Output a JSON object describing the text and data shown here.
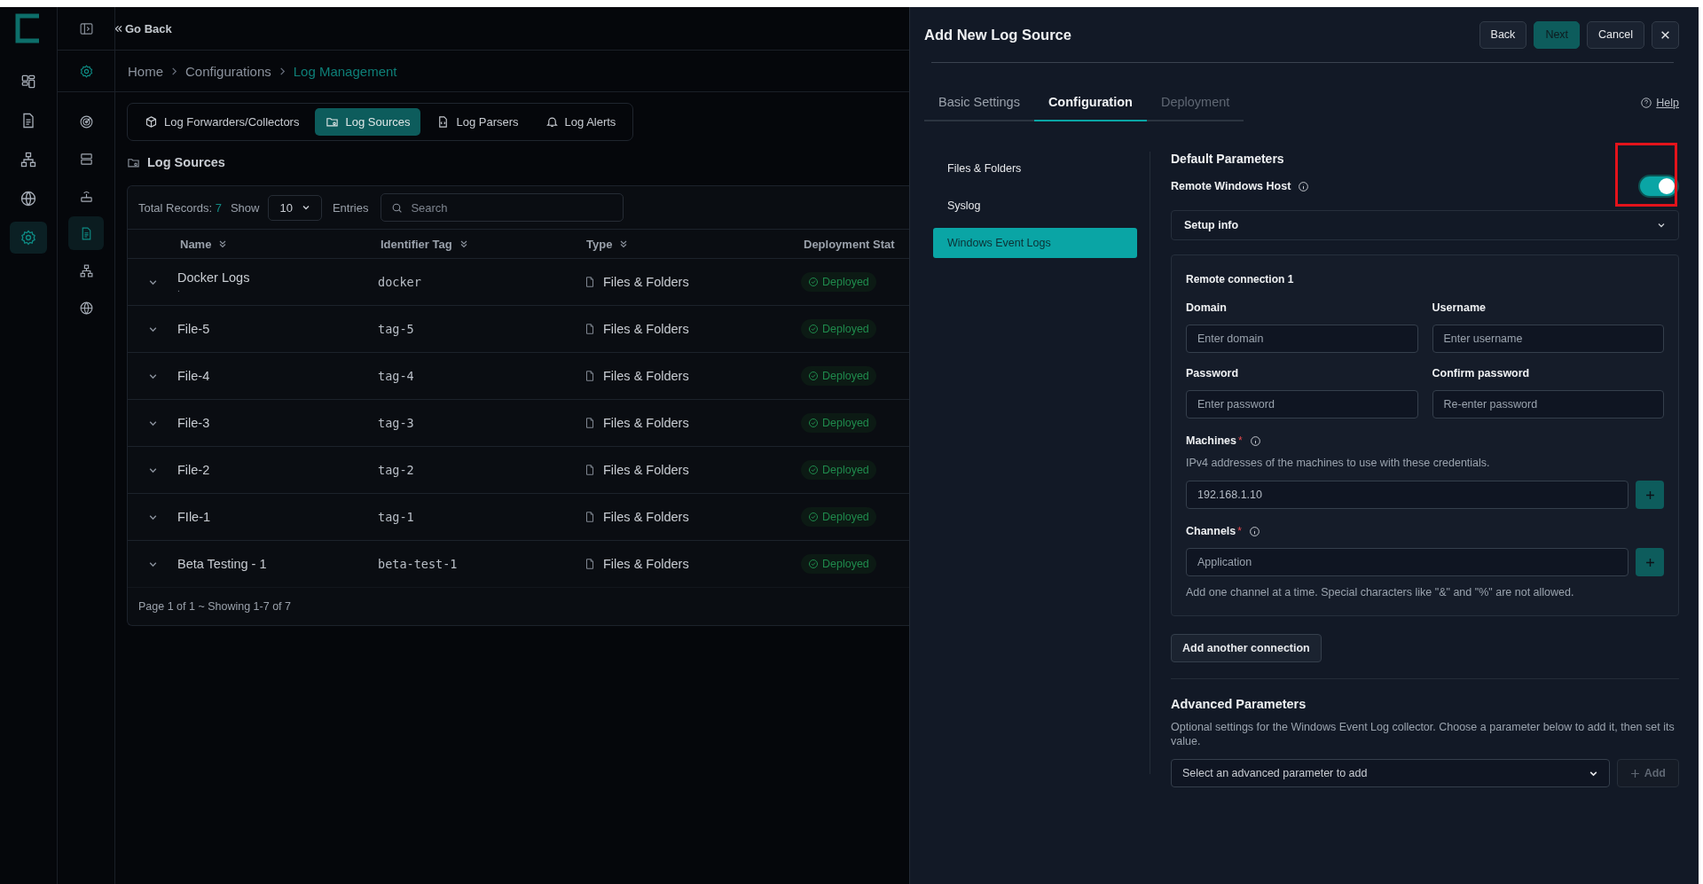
{
  "app_rail": {
    "items": [
      {
        "kind": "dashboard",
        "selected": false
      },
      {
        "kind": "document",
        "selected": false
      },
      {
        "kind": "network",
        "selected": false
      },
      {
        "kind": "globe",
        "selected": false
      },
      {
        "kind": "settings",
        "selected": true
      }
    ]
  },
  "nav_rail": {
    "items": [
      {
        "kind": "settings",
        "selected": false
      },
      {
        "kind": "radar",
        "selected": false
      },
      {
        "kind": "server",
        "selected": false
      },
      {
        "kind": "router",
        "selected": false
      },
      {
        "kind": "document",
        "selected": true
      },
      {
        "kind": "network",
        "selected": false
      },
      {
        "kind": "globe",
        "selected": false
      }
    ]
  },
  "topbar": {
    "go_back": "Go Back"
  },
  "breadcrumb": [
    {
      "label": "Home",
      "current": false
    },
    {
      "label": "Configurations",
      "current": false
    },
    {
      "label": "Log Management",
      "current": true
    }
  ],
  "section_tabs": [
    {
      "label": "Log Forwarders/Collectors",
      "kind": "box",
      "selected": false
    },
    {
      "label": "Log Sources",
      "kind": "folder",
      "selected": true
    },
    {
      "label": "Log Parsers",
      "kind": "code",
      "selected": false
    },
    {
      "label": "Log Alerts",
      "kind": "bell",
      "selected": false
    }
  ],
  "section_title": "Log Sources",
  "table": {
    "total_label": "Total Records:",
    "total": "7",
    "show_label": "Show",
    "page_size": "10",
    "entries_label": "Entries",
    "search_placeholder": "Search",
    "columns": [
      "Name",
      "Identifier Tag",
      "Type",
      "Deployment Stat"
    ],
    "rows": [
      {
        "name": "Docker Logs",
        "description": ".",
        "tag": "docker",
        "type": "Files & Folders",
        "status": "Deployed"
      },
      {
        "name": "File-5",
        "tag": "tag-5",
        "type": "Files & Folders",
        "status": "Deployed"
      },
      {
        "name": "File-4",
        "tag": "tag-4",
        "type": "Files & Folders",
        "status": "Deployed"
      },
      {
        "name": "File-3",
        "tag": "tag-3",
        "type": "Files & Folders",
        "status": "Deployed"
      },
      {
        "name": "File-2",
        "tag": "tag-2",
        "type": "Files & Folders",
        "status": "Deployed"
      },
      {
        "name": "FIle-1",
        "tag": "tag-1",
        "type": "Files & Folders",
        "status": "Deployed"
      },
      {
        "name": "Beta Testing - 1",
        "tag": "beta-test-1",
        "type": "Files & Folders",
        "status": "Deployed"
      }
    ],
    "footer": "Page 1 of 1 ~ Showing 1-7 of 7"
  },
  "panel": {
    "title": "Add New Log Source",
    "buttons": [
      {
        "label": "Back",
        "kind": "secondary"
      },
      {
        "label": "Next",
        "kind": "primary"
      },
      {
        "label": "Cancel",
        "kind": "secondary"
      }
    ],
    "tabs": [
      {
        "label": "Basic Settings",
        "selected": false,
        "disabled": false
      },
      {
        "label": "Configuration",
        "selected": true,
        "disabled": false
      },
      {
        "label": "Deployment",
        "selected": false,
        "disabled": true
      }
    ],
    "help": "Help",
    "source_types": [
      {
        "label": "Files & Folders",
        "selected": false
      },
      {
        "label": "Syslog",
        "selected": false
      },
      {
        "label": "Windows Event Logs",
        "selected": true
      }
    ],
    "default_title": "Default Parameters",
    "remote_host": {
      "label": "Remote Windows Host",
      "on": true,
      "highlighted": true
    },
    "setup_info": {
      "label": "Setup info",
      "expanded": false
    },
    "connection": {
      "title": "Remote connection 1",
      "fields": [
        {
          "label": "Domain",
          "placeholder": "Enter domain"
        },
        {
          "label": "Username",
          "placeholder": "Enter username"
        },
        {
          "label": "Password",
          "placeholder": "Enter password"
        },
        {
          "label": "Confirm password",
          "placeholder": "Re-enter password"
        }
      ],
      "machines": {
        "label": "Machines",
        "required_mark": "*",
        "help": "IPv4 addresses of the machines to use with these credentials.",
        "value": "192.168.1.10"
      },
      "channels": {
        "label": "Channels",
        "required_mark": "*",
        "placeholder": "Application",
        "hint": "Add one channel at a time. Special characters like \"&\" and \"%\" are not allowed."
      }
    },
    "add_connection": "Add another connection",
    "advanced": {
      "title": "Advanced Parameters",
      "description": "Optional settings for the Windows Event Log collector. Choose a parameter below to add it, then set its value.",
      "select_placeholder": "Select an advanced parameter to add",
      "add_label": "Add",
      "add_disabled": true
    }
  }
}
